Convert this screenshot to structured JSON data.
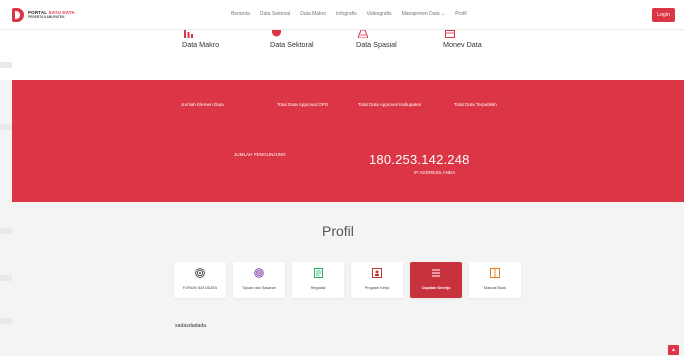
{
  "brand": {
    "title_main": "PORTAL",
    "title_accent": "SATU DATA",
    "subtitle": "PESERTA KABUPATEN"
  },
  "nav": {
    "items": [
      "Beranda",
      "Data Sektoral",
      "Data Makro",
      "Infografis",
      "Videografis",
      "Manajemen Data ⌄",
      "Profil"
    ],
    "login_label": "Login"
  },
  "categories": [
    {
      "label": "Data Makro",
      "icon": "bar-chart-icon"
    },
    {
      "label": "Data Sektoral",
      "icon": "pie-chart-icon"
    },
    {
      "label": "Data Spasial",
      "icon": "map-icon"
    },
    {
      "label": "Monev Data",
      "icon": "calendar-icon"
    }
  ],
  "stats": {
    "labels": [
      "Jumlah Elemen Data",
      "Total Data Approval OPD",
      "Total Data Approval Kabupaten",
      "Total Data Terpublish"
    ],
    "visitors_label": "JUMLAH PENGUNJUNG",
    "ip_value": "180.253.142.248",
    "ip_caption": "IP ADDRESS ANDA"
  },
  "profil": {
    "title": "Profil",
    "cards": [
      {
        "label": "FORUM SATUDATA",
        "icon": "target-icon",
        "active": false
      },
      {
        "label": "Tujuan dan Sasaran",
        "icon": "fingerprint-icon",
        "active": false
      },
      {
        "label": "Regulasi",
        "icon": "document-icon",
        "active": false
      },
      {
        "label": "Program Kerja",
        "icon": "person-board-icon",
        "active": false
      },
      {
        "label": "Capaian Kinerja",
        "icon": "list-icon",
        "active": true
      },
      {
        "label": "Manual Book",
        "icon": "book-icon",
        "active": false
      }
    ],
    "content_text": "sadasdadada"
  },
  "colors": {
    "brand_red": "#dc3545",
    "active_card": "#c8323c",
    "background": "#f4f4f5",
    "purple_icon": "#8e44ad",
    "green_icon": "#27ae60",
    "orange_icon": "#e67e22"
  },
  "scroll_top_icon": "arrow-up-icon"
}
